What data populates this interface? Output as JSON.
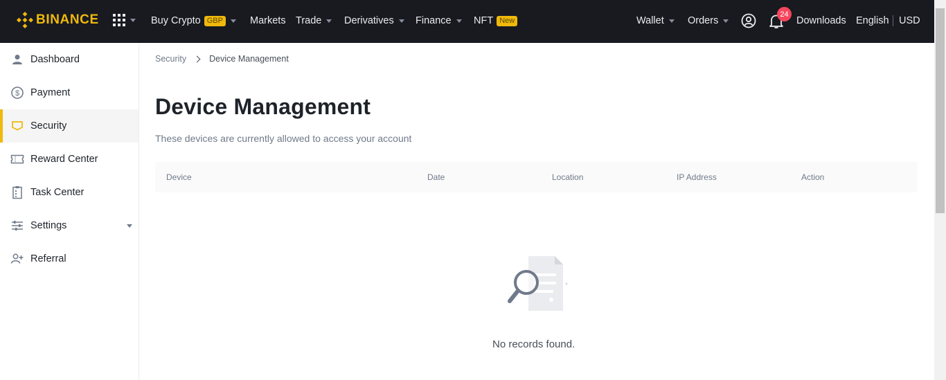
{
  "brand": {
    "name": "BINANCE",
    "accent": "#f0b90b"
  },
  "header": {
    "nav": [
      {
        "label": "Buy Crypto",
        "tag": "GBP"
      },
      {
        "label": "Markets"
      },
      {
        "label": "Trade"
      },
      {
        "label": "Derivatives"
      },
      {
        "label": "Finance"
      },
      {
        "label": "NFT",
        "tag": "New"
      }
    ],
    "right": {
      "wallet": "Wallet",
      "orders": "Orders",
      "notifications_count": "24",
      "downloads": "Downloads",
      "language": "English",
      "currency": "USD"
    }
  },
  "sidebar": {
    "items": [
      {
        "label": "Dashboard",
        "icon": "user-icon"
      },
      {
        "label": "Payment",
        "icon": "dollar-circle-icon"
      },
      {
        "label": "Security",
        "icon": "shield-icon",
        "active": true
      },
      {
        "label": "Reward Center",
        "icon": "ticket-icon"
      },
      {
        "label": "Task Center",
        "icon": "clipboard-icon"
      },
      {
        "label": "Settings",
        "icon": "sliders-icon"
      },
      {
        "label": "Referral",
        "icon": "user-plus-icon"
      }
    ]
  },
  "main": {
    "breadcrumb": {
      "parent": "Security",
      "current": "Device Management"
    },
    "title": "Device Management",
    "subtitle": "These devices are currently allowed to access your account",
    "table": {
      "columns": [
        "Device",
        "Date",
        "Location",
        "IP Address",
        "Action"
      ],
      "rows": []
    },
    "empty_text": "No records found."
  }
}
